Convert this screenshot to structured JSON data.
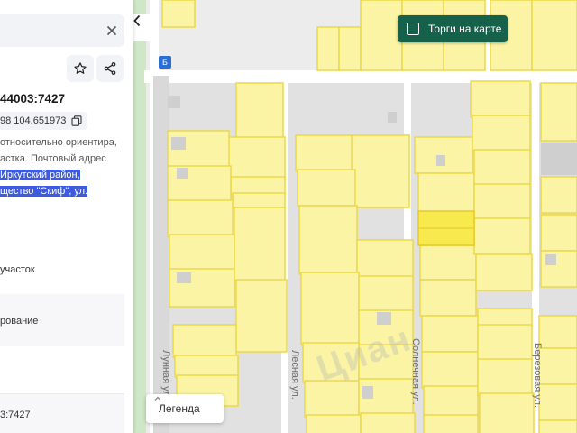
{
  "panel": {
    "cadastral_number": "44003:7427",
    "coordinates": "98 104.651973",
    "desc_lines": [
      "относительно ориентира,",
      "астка. Почтовый адрес",
      "Иркутский район,",
      "щество \"Скиф\", ул."
    ],
    "row_category": "участок",
    "row_usage": "рование",
    "bottom_number": "3:7427"
  },
  "map": {
    "auction_button": "Торги на карте",
    "legend_button": "Легенда",
    "streets": [
      "Лунная ул.",
      "Лесная ул.",
      "Солнечная ул.",
      "Березовая ул."
    ],
    "bus_stop_label": "Б",
    "watermark": "Циан"
  },
  "icons": {
    "close": "close-icon",
    "favorite": "star-icon",
    "share": "share-icon",
    "copy": "copy-icon",
    "collapse": "chevron-left-icon",
    "legend_chevron": "chevron-up-icon",
    "pin": "location-pin-icon"
  },
  "colors": {
    "parcel_fill": "#fbf4a4",
    "parcel_border": "#ecd84a",
    "selected_parcel": "#f7e94e",
    "pin": "#2f6fe3",
    "button_green": "#15614a",
    "highlight": "#3d5bdc"
  }
}
